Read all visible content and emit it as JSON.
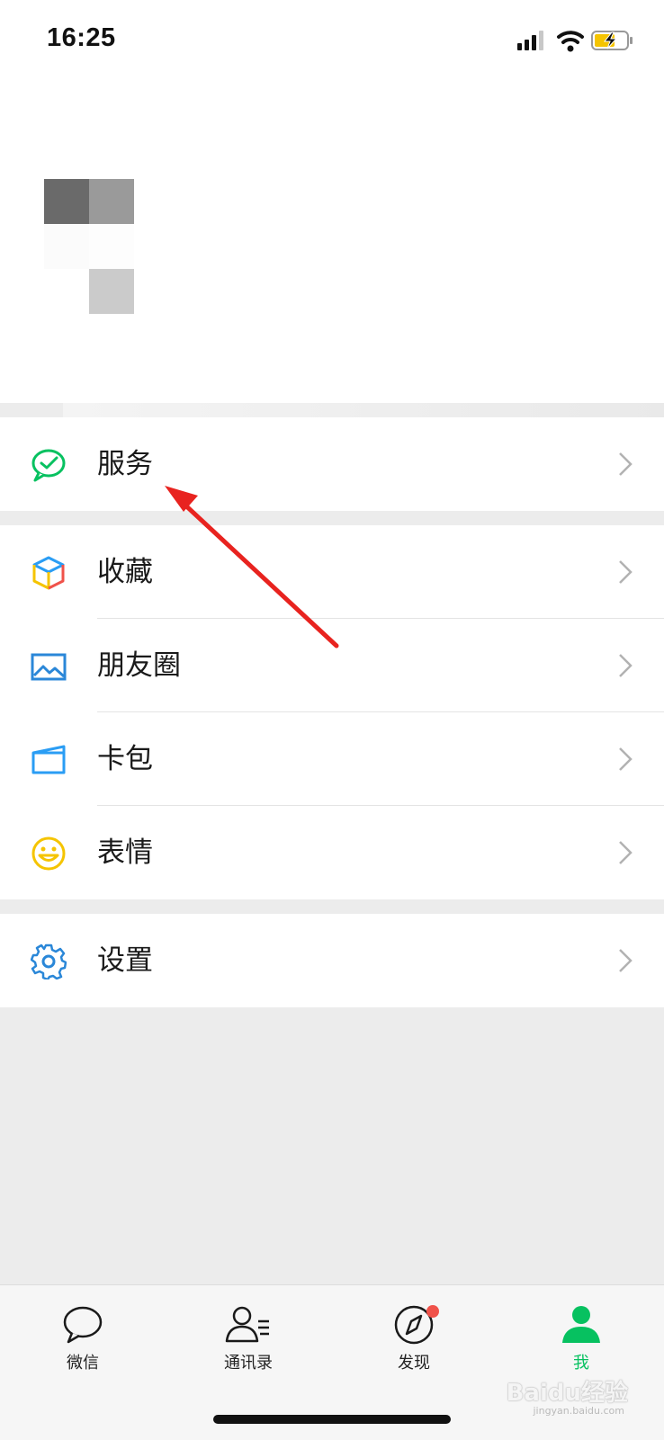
{
  "status_bar": {
    "time": "16:25"
  },
  "menu": {
    "service": {
      "label": "服务",
      "icon": "service-icon"
    },
    "favorites": {
      "label": "收藏",
      "icon": "box-icon"
    },
    "moments": {
      "label": "朋友圈",
      "icon": "image-icon"
    },
    "cards": {
      "label": "卡包",
      "icon": "wallet-icon"
    },
    "stickers": {
      "label": "表情",
      "icon": "smile-icon"
    },
    "settings": {
      "label": "设置",
      "icon": "gear-icon"
    }
  },
  "tabbar": {
    "chats": "微信",
    "contacts": "通讯录",
    "discover": "发现",
    "me": "我"
  },
  "colors": {
    "accent_green": "#07c160",
    "badge_red": "#f0524a",
    "annotation_arrow": "#e8231f"
  },
  "watermark": {
    "text": "Baidu经验",
    "sub": "jingyan.baidu.com"
  }
}
